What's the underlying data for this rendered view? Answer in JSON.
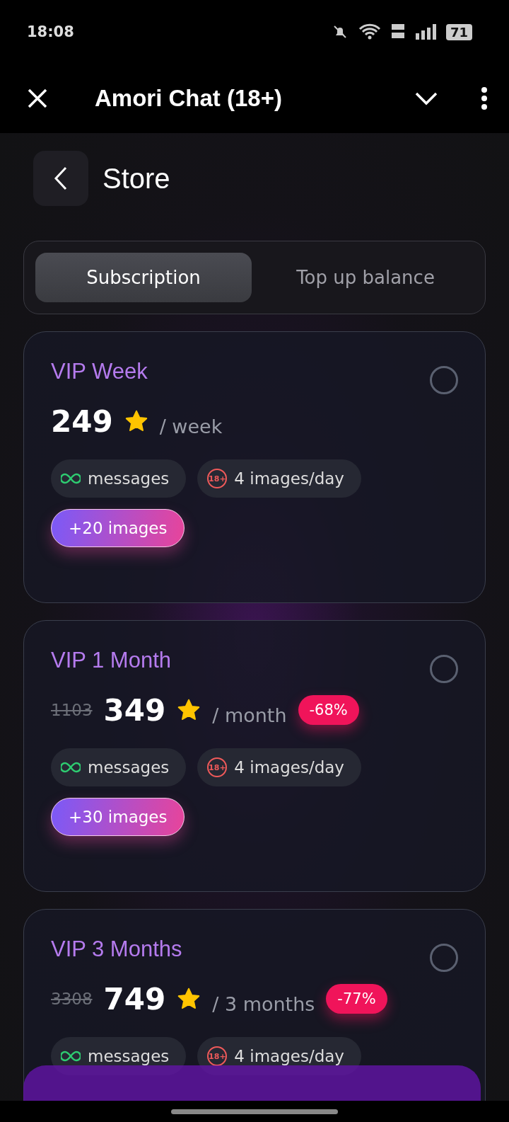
{
  "status_bar": {
    "time": "18:08",
    "battery": "71"
  },
  "app_bar": {
    "title": "Amori Chat (18+)"
  },
  "header": {
    "title": "Store"
  },
  "tabs": [
    {
      "label": "Subscription",
      "selected": true
    },
    {
      "label": "Top up balance",
      "selected": false
    }
  ],
  "plans": [
    {
      "name": "VIP Week",
      "price": "249",
      "period": "/ week",
      "selected": false,
      "features": [
        {
          "kind": "unlimited",
          "label": "messages"
        },
        {
          "kind": "adult",
          "icon_text": "18+",
          "label": "4 images/day"
        }
      ],
      "bonus": "+20 images"
    },
    {
      "name": "VIP 1 Month",
      "old_price": "1103",
      "price": "349",
      "period": "/ month",
      "discount": "-68%",
      "selected": false,
      "features": [
        {
          "kind": "unlimited",
          "label": "messages"
        },
        {
          "kind": "adult",
          "icon_text": "18+",
          "label": "4 images/day"
        }
      ],
      "bonus": "+30 images"
    },
    {
      "name": "VIP 3 Months",
      "old_price": "3308",
      "price": "749",
      "period": "/ 3 months",
      "discount": "-77%",
      "selected": false,
      "features": [
        {
          "kind": "unlimited",
          "label": "messages"
        },
        {
          "kind": "adult",
          "icon_text": "18+",
          "label": "4 images/day"
        }
      ]
    }
  ]
}
